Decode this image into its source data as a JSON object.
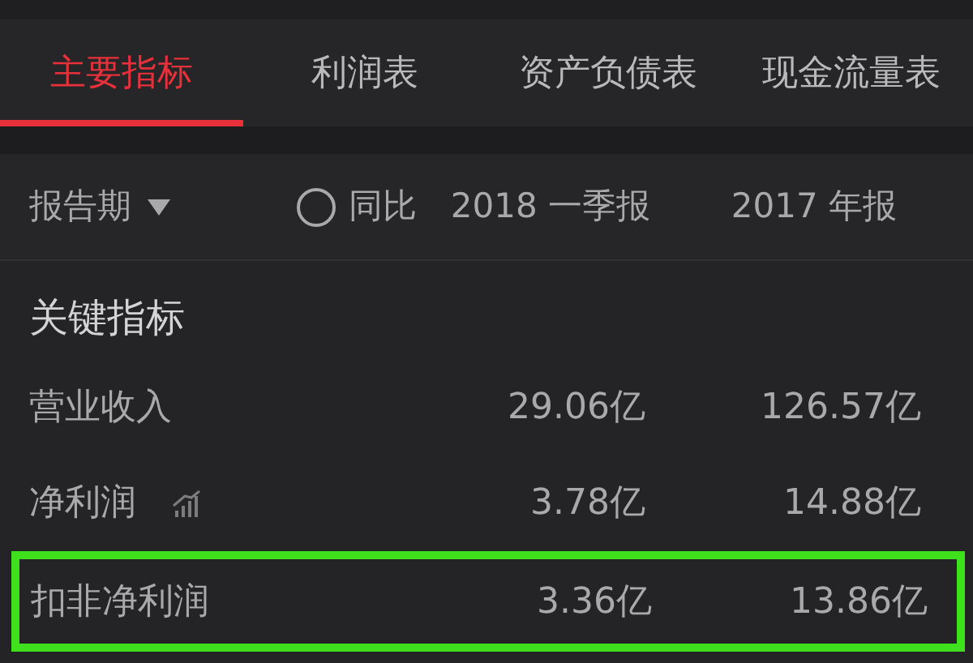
{
  "tabs": [
    {
      "label": "主要指标",
      "selected": true
    },
    {
      "label": "利润表",
      "selected": false
    },
    {
      "label": "资产负债表",
      "selected": false
    },
    {
      "label": "现金流量表",
      "selected": false
    }
  ],
  "header": {
    "period_label": "报告期",
    "compare": {
      "label": "同比",
      "checked": false
    },
    "columns": [
      "2018 一季报",
      "2017 年报"
    ]
  },
  "section_title": "关键指标",
  "rows": [
    {
      "label": "营业收入",
      "trend_icon": false,
      "highlighted": false,
      "values": [
        "29.06亿",
        "126.57亿"
      ]
    },
    {
      "label": "净利润",
      "trend_icon": true,
      "highlighted": false,
      "values": [
        "3.78亿",
        "14.88亿"
      ]
    },
    {
      "label": "扣非净利润",
      "trend_icon": false,
      "highlighted": true,
      "values": [
        "3.36亿",
        "13.86亿"
      ]
    }
  ]
}
